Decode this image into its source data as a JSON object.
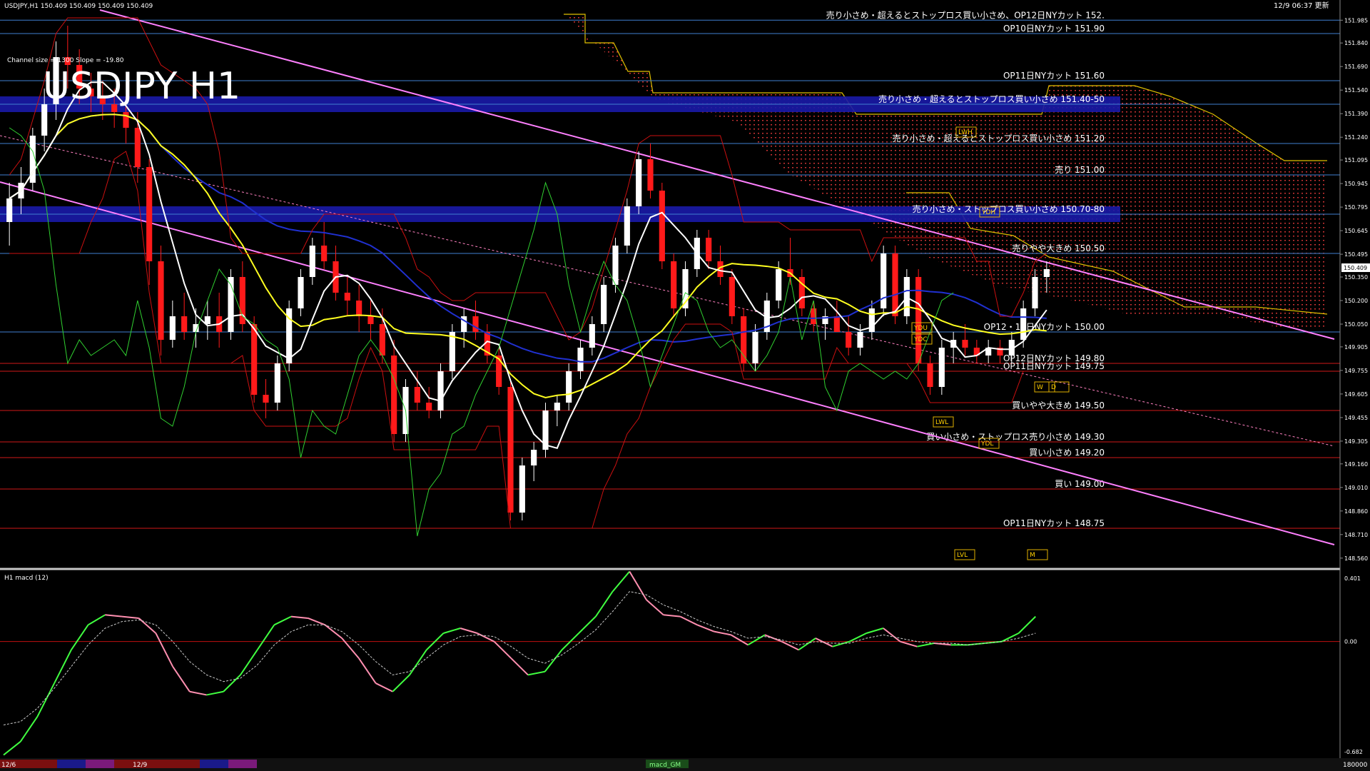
{
  "window": {
    "header_left": "USDJPY,H1  150.409 150.409 150.409 150.409",
    "header_right": "12/9 06:37 更新",
    "symbol_big": "USDJPY H1",
    "channel_text": "Channel size = 1300 Slope = -19.80",
    "subwindow_label": "H1 macd (12)",
    "status_left": "12/6",
    "status_mid": "12/9",
    "status_tab": "macd_GM",
    "status_right": "180000"
  },
  "colors": {
    "background": "#000000",
    "bull_candle": "#ffffff",
    "bear_candle": "#ff1a1a",
    "channel_line": "#ff80ff",
    "sell_line": "#3f7fd0",
    "buy_line": "#d01818",
    "zone_band": "#1a1aa8",
    "ma_white": "#ffffff",
    "ma_yellow": "#ffff20",
    "ma_blue": "#2030d0",
    "bollinger": "#cc1010",
    "lagging_green": "#30d030",
    "kumo_dots": "#ff4040",
    "macd_up": "#40ff40",
    "macd_down": "#ff8fb0",
    "macd_signal": "#cccccc"
  },
  "price_axis": {
    "labels": [
      "151.985",
      "151.840",
      "151.690",
      "151.540",
      "151.390",
      "151.240",
      "151.095",
      "150.945",
      "150.795",
      "150.645",
      "150.495",
      "150.350",
      "150.200",
      "150.050",
      "149.905",
      "149.755",
      "149.605",
      "149.455",
      "149.305",
      "149.160",
      "149.010",
      "148.860",
      "148.710",
      "148.560"
    ],
    "current": "150.409"
  },
  "macd_axis": {
    "top": "0.401",
    "zero": "0.00",
    "bottom": "-0.682"
  },
  "levels": [
    {
      "text": "売り小さめ・超えるとストップロス買い小さめ、OP12日NYカット 152.",
      "price": 151.985,
      "type": "sell"
    },
    {
      "text": "OP10日NYカット 151.90",
      "price": 151.9,
      "type": "sell"
    },
    {
      "text": "OP11日NYカット 151.60",
      "price": 151.6,
      "type": "sell"
    },
    {
      "text": "売り小さめ・超えるとストップロス買い小さめ 151.40-50",
      "price": 151.45,
      "type": "band"
    },
    {
      "text": "売り小さめ・超えるとストップロス買い小さめ 151.20",
      "price": 151.2,
      "type": "sell"
    },
    {
      "text": "売り 151.00",
      "price": 151.0,
      "type": "sell"
    },
    {
      "text": "売り小さめ・ストップロス買い小さめ 150.70-80",
      "price": 150.75,
      "type": "band"
    },
    {
      "text": "売りやや大きめ 150.50",
      "price": 150.5,
      "type": "sell"
    },
    {
      "text": "OP12・16日NYカット 150.00",
      "price": 150.0,
      "type": "sell"
    },
    {
      "text": "OP12日NYカット 149.80",
      "price": 149.8,
      "type": "buy"
    },
    {
      "text": "OP11日NYカット 149.75",
      "price": 149.75,
      "type": "buy"
    },
    {
      "text": "買いやや大きめ 149.50",
      "price": 149.5,
      "type": "buy"
    },
    {
      "text": "買い小さめ・ストップロス売り小さめ 149.30",
      "price": 149.3,
      "type": "buy"
    },
    {
      "text": "買い小さめ 149.20",
      "price": 149.2,
      "type": "buy"
    },
    {
      "text": "買い 149.00",
      "price": 149.0,
      "type": "buy"
    },
    {
      "text": "OP11日NYカット 148.75",
      "price": 148.75,
      "type": "buy"
    }
  ],
  "boxes": [
    "YDH",
    "LWH",
    "YDL",
    "LWL",
    "LVL",
    "YDU",
    "YDC",
    "W",
    "D",
    "M"
  ],
  "chart_data": {
    "type": "candlestick",
    "timeframe": "H1",
    "symbol": "USDJPY",
    "ylim": [
      148.5,
      152.05
    ],
    "candles": [
      [
        150.7,
        150.95,
        150.55,
        150.85
      ],
      [
        150.85,
        151.05,
        150.75,
        150.95
      ],
      [
        150.95,
        151.3,
        150.9,
        151.25
      ],
      [
        151.25,
        151.55,
        151.15,
        151.45
      ],
      [
        151.45,
        151.85,
        151.35,
        151.75
      ],
      [
        151.75,
        151.95,
        151.55,
        151.7
      ],
      [
        151.7,
        151.8,
        151.45,
        151.55
      ],
      [
        151.55,
        151.65,
        151.4,
        151.5
      ],
      [
        151.5,
        151.6,
        151.35,
        151.45
      ],
      [
        151.45,
        151.55,
        151.3,
        151.4
      ],
      [
        151.4,
        151.5,
        151.2,
        151.3
      ],
      [
        151.3,
        151.4,
        150.95,
        151.05
      ],
      [
        151.05,
        151.1,
        150.3,
        150.45
      ],
      [
        150.45,
        150.55,
        149.85,
        149.95
      ],
      [
        149.95,
        150.2,
        149.9,
        150.1
      ],
      [
        150.1,
        150.25,
        149.95,
        150.0
      ],
      [
        150.0,
        150.15,
        149.9,
        150.05
      ],
      [
        150.05,
        150.2,
        149.95,
        150.1
      ],
      [
        150.1,
        150.25,
        149.9,
        150.0
      ],
      [
        150.0,
        150.4,
        149.95,
        150.35
      ],
      [
        150.35,
        150.45,
        150.0,
        150.05
      ],
      [
        150.05,
        150.1,
        149.55,
        149.6
      ],
      [
        149.6,
        149.7,
        149.45,
        149.55
      ],
      [
        149.55,
        149.85,
        149.5,
        149.8
      ],
      [
        149.8,
        150.2,
        149.75,
        150.15
      ],
      [
        150.15,
        150.4,
        150.1,
        150.35
      ],
      [
        150.35,
        150.6,
        150.3,
        150.55
      ],
      [
        150.55,
        150.7,
        150.4,
        150.45
      ],
      [
        150.45,
        150.55,
        150.2,
        150.25
      ],
      [
        150.25,
        150.35,
        150.1,
        150.2
      ],
      [
        150.2,
        150.3,
        150.0,
        150.1
      ],
      [
        150.1,
        150.2,
        149.95,
        150.05
      ],
      [
        150.05,
        150.15,
        149.8,
        149.85
      ],
      [
        149.85,
        149.95,
        149.3,
        149.35
      ],
      [
        149.35,
        149.7,
        149.3,
        149.65
      ],
      [
        149.65,
        149.75,
        149.5,
        149.55
      ],
      [
        149.55,
        149.65,
        149.45,
        149.5
      ],
      [
        149.5,
        149.8,
        149.45,
        149.75
      ],
      [
        149.75,
        150.05,
        149.7,
        150.0
      ],
      [
        150.0,
        150.15,
        149.9,
        150.1
      ],
      [
        150.1,
        150.2,
        149.95,
        150.0
      ],
      [
        150.0,
        150.05,
        149.8,
        149.85
      ],
      [
        149.85,
        149.9,
        149.6,
        149.65
      ],
      [
        149.65,
        149.7,
        148.8,
        148.85
      ],
      [
        148.85,
        149.2,
        148.8,
        149.15
      ],
      [
        149.15,
        149.3,
        149.05,
        149.25
      ],
      [
        149.25,
        149.55,
        149.2,
        149.5
      ],
      [
        149.5,
        149.6,
        149.4,
        149.55
      ],
      [
        149.55,
        149.8,
        149.5,
        149.75
      ],
      [
        149.75,
        149.95,
        149.7,
        149.9
      ],
      [
        149.9,
        150.1,
        149.85,
        150.05
      ],
      [
        150.05,
        150.35,
        150.0,
        150.3
      ],
      [
        150.3,
        150.6,
        150.25,
        150.55
      ],
      [
        150.55,
        150.85,
        150.5,
        150.8
      ],
      [
        150.8,
        151.15,
        150.75,
        151.1
      ],
      [
        151.1,
        151.2,
        150.85,
        150.9
      ],
      [
        150.9,
        150.95,
        150.4,
        150.45
      ],
      [
        150.45,
        150.5,
        150.1,
        150.15
      ],
      [
        150.15,
        150.45,
        150.1,
        150.4
      ],
      [
        150.4,
        150.65,
        150.35,
        150.6
      ],
      [
        150.6,
        150.65,
        150.4,
        150.45
      ],
      [
        150.45,
        150.55,
        150.3,
        150.35
      ],
      [
        150.35,
        150.4,
        150.05,
        150.1
      ],
      [
        150.1,
        150.15,
        149.75,
        149.8
      ],
      [
        149.8,
        150.05,
        149.75,
        150.0
      ],
      [
        150.0,
        150.25,
        149.95,
        150.2
      ],
      [
        150.2,
        150.45,
        150.15,
        150.4
      ],
      [
        150.4,
        150.6,
        150.3,
        150.35
      ],
      [
        150.35,
        150.4,
        150.1,
        150.15
      ],
      [
        150.15,
        150.2,
        150.0,
        150.05
      ],
      [
        150.05,
        150.15,
        149.95,
        150.1
      ],
      [
        150.1,
        150.2,
        150.0,
        150.0
      ],
      [
        150.0,
        150.1,
        149.85,
        149.9
      ],
      [
        149.9,
        150.05,
        149.85,
        150.0
      ],
      [
        150.0,
        150.2,
        149.95,
        150.15
      ],
      [
        150.15,
        150.55,
        150.1,
        150.5
      ],
      [
        150.5,
        150.55,
        150.05,
        150.1
      ],
      [
        150.1,
        150.4,
        150.05,
        150.35
      ],
      [
        150.35,
        150.4,
        149.75,
        149.8
      ],
      [
        149.8,
        149.85,
        149.6,
        149.65
      ],
      [
        149.65,
        149.95,
        149.6,
        149.9
      ],
      [
        149.9,
        150.0,
        149.8,
        149.95
      ],
      [
        149.95,
        150.05,
        149.85,
        149.9
      ],
      [
        149.9,
        149.95,
        149.8,
        149.85
      ],
      [
        149.85,
        149.95,
        149.8,
        149.9
      ],
      [
        149.9,
        149.95,
        149.8,
        149.85
      ],
      [
        149.85,
        150.0,
        149.8,
        149.95
      ],
      [
        149.95,
        150.2,
        149.9,
        150.15
      ],
      [
        150.15,
        150.4,
        150.1,
        150.35
      ],
      [
        150.35,
        150.45,
        150.25,
        150.4
      ]
    ],
    "macd": {
      "values": [
        -0.68,
        -0.6,
        -0.45,
        -0.25,
        -0.05,
        0.1,
        0.16,
        0.15,
        0.14,
        0.05,
        -0.15,
        -0.3,
        -0.32,
        -0.3,
        -0.2,
        -0.05,
        0.1,
        0.15,
        0.14,
        0.1,
        0.02,
        -0.1,
        -0.25,
        -0.3,
        -0.2,
        -0.05,
        0.05,
        0.08,
        0.05,
        0.0,
        -0.1,
        -0.2,
        -0.18,
        -0.05,
        0.05,
        0.15,
        0.3,
        0.42,
        0.25,
        0.16,
        0.15,
        0.1,
        0.06,
        0.04,
        -0.02,
        0.04,
        0.0,
        -0.05,
        0.02,
        -0.03,
        0.0,
        0.05,
        0.08,
        0.0,
        -0.03,
        -0.01,
        -0.02,
        -0.02,
        -0.01,
        0.0,
        0.05,
        0.15
      ],
      "signal": [
        -0.5,
        -0.48,
        -0.4,
        -0.28,
        -0.15,
        -0.02,
        0.08,
        0.12,
        0.13,
        0.1,
        0.0,
        -0.12,
        -0.2,
        -0.24,
        -0.22,
        -0.14,
        -0.02,
        0.06,
        0.1,
        0.1,
        0.06,
        -0.02,
        -0.12,
        -0.2,
        -0.18,
        -0.1,
        -0.02,
        0.03,
        0.04,
        0.03,
        -0.03,
        -0.1,
        -0.13,
        -0.08,
        -0.01,
        0.07,
        0.18,
        0.3,
        0.28,
        0.22,
        0.18,
        0.13,
        0.09,
        0.06,
        0.02,
        0.03,
        0.01,
        -0.02,
        0.0,
        -0.01,
        -0.01,
        0.02,
        0.04,
        0.02,
        0.0,
        -0.01,
        -0.01,
        -0.02,
        -0.01,
        0.0,
        0.02,
        0.05
      ],
      "ylim": [
        -0.682,
        0.401
      ]
    }
  }
}
